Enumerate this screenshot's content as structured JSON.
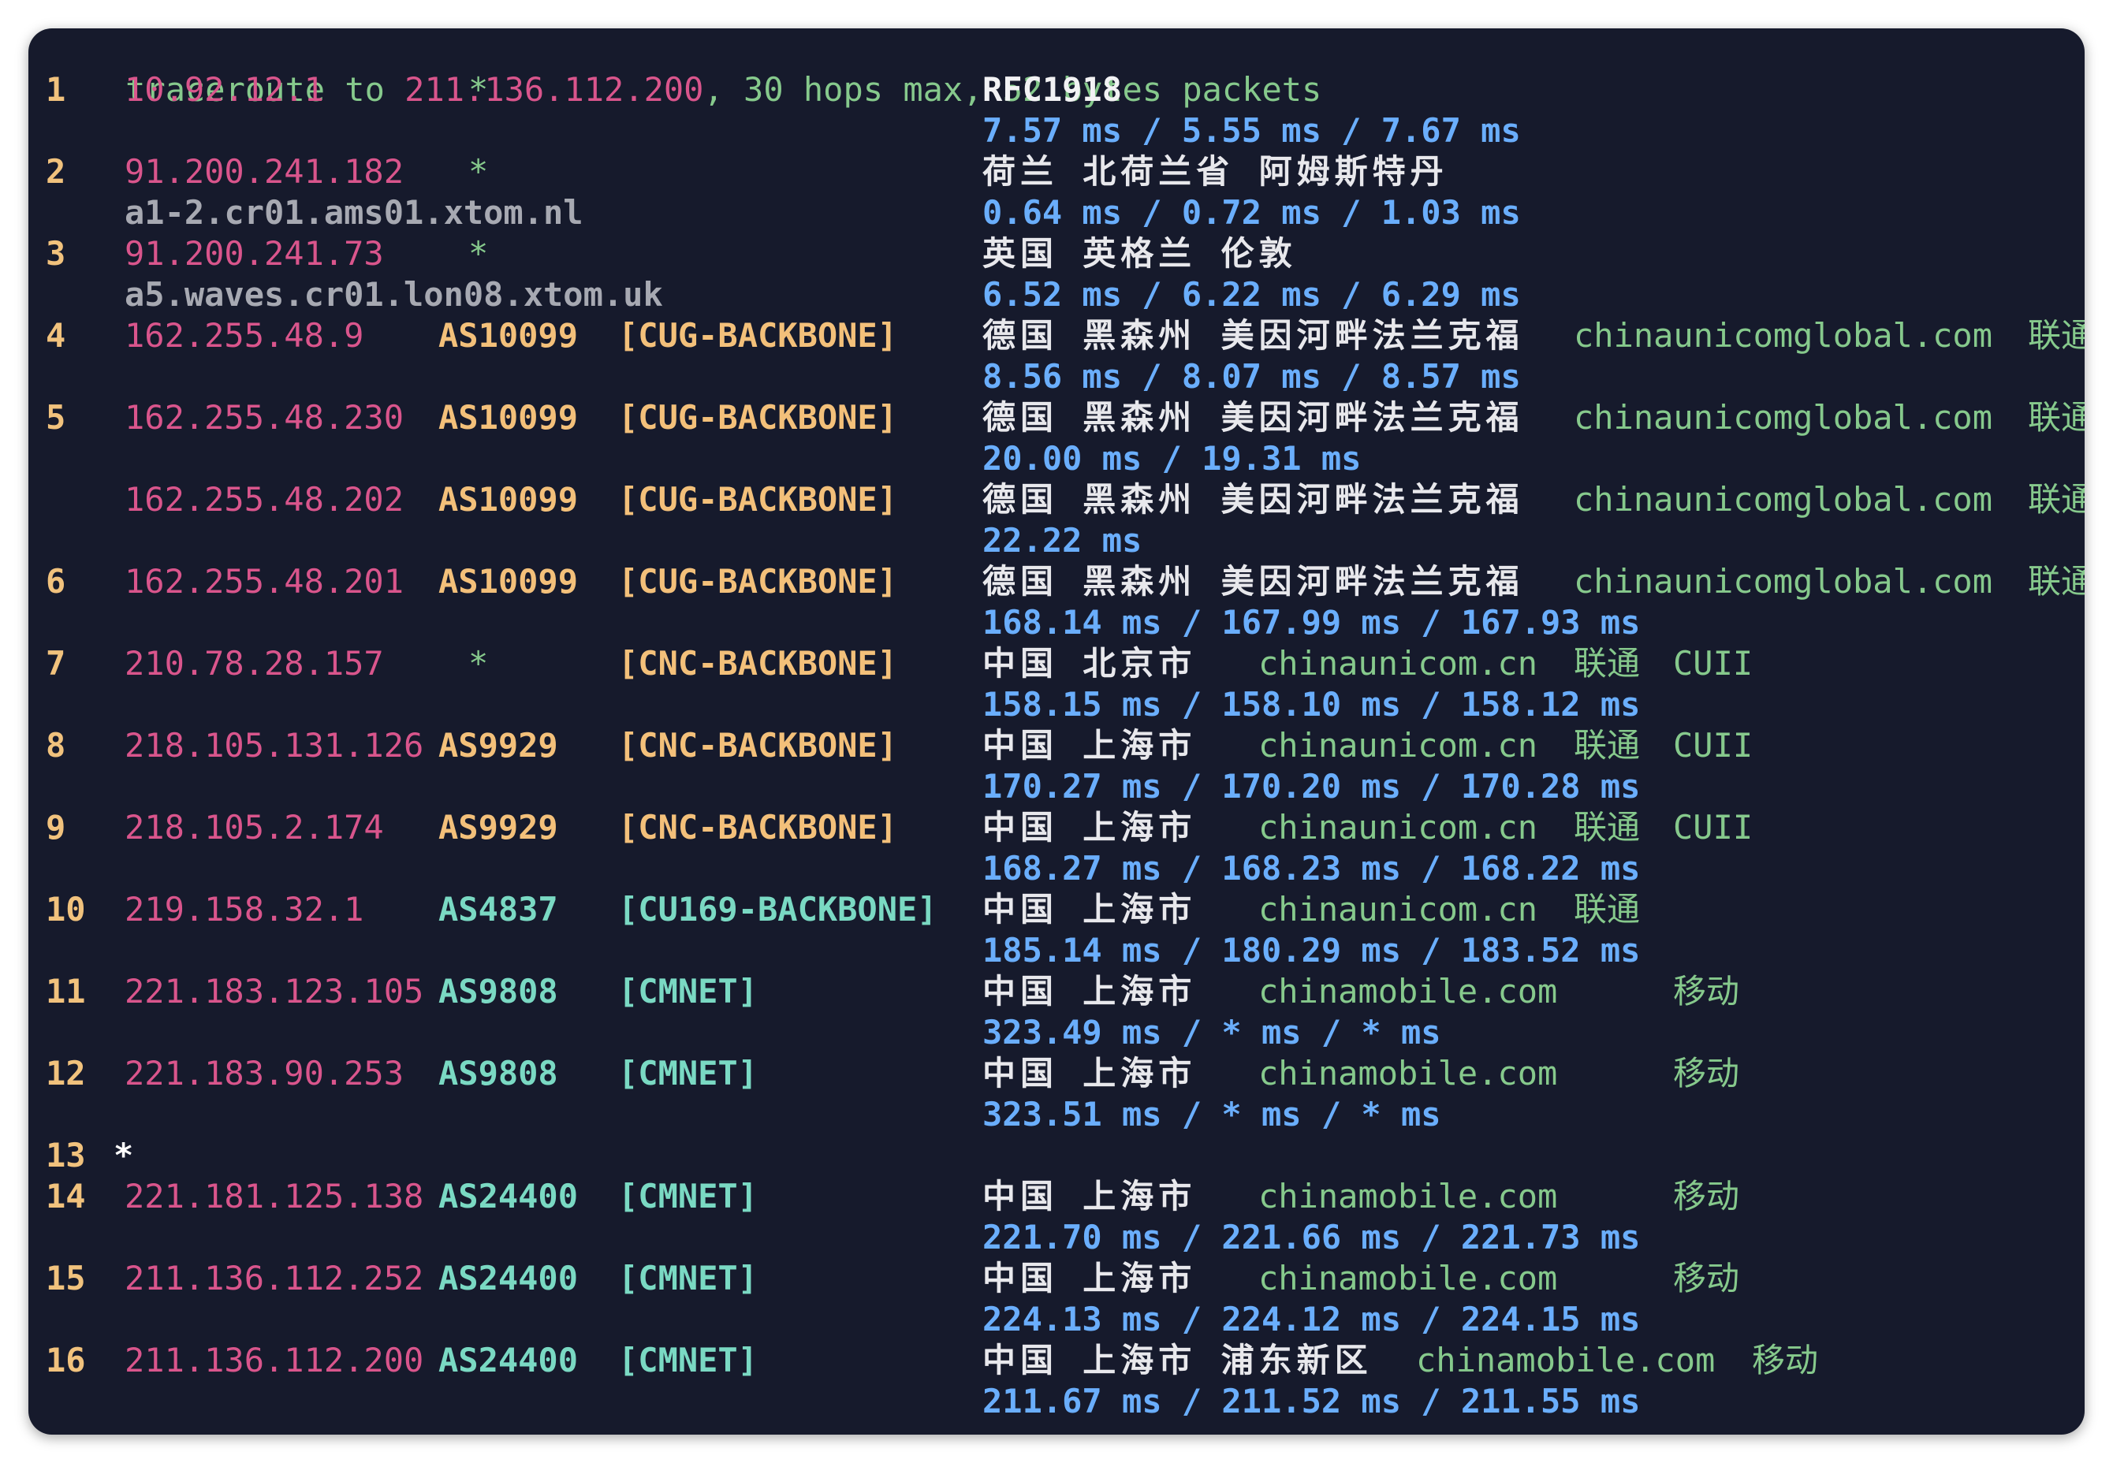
{
  "header": {
    "prefix": "traceroute to ",
    "target": "211.136.112.200",
    "suffix": ", 30 hops max, 52 bytes packets"
  },
  "hops": [
    {
      "hop": "1",
      "ip": "10.92.12.1",
      "asn": "*",
      "tag": "",
      "geo": "RFC1918",
      "domain": "",
      "isp": "",
      "extra": "",
      "host": "",
      "latency": "7.57 ms / 5.55 ms / 7.67 ms"
    },
    {
      "hop": "2",
      "ip": "91.200.241.182",
      "asn": "*",
      "tag": "",
      "geo": "荷兰 北荷兰省 阿姆斯特丹",
      "domain": "",
      "isp": "",
      "extra": "",
      "host": "a1-2.cr01.ams01.xtom.nl",
      "latency": "0.64 ms / 0.72 ms / 1.03 ms"
    },
    {
      "hop": "3",
      "ip": "91.200.241.73",
      "asn": "*",
      "tag": "",
      "geo": "英国 英格兰 伦敦",
      "domain": "",
      "isp": "",
      "extra": "",
      "host": "a5.waves.cr01.lon08.xtom.uk",
      "latency": "6.52 ms / 6.22 ms / 6.29 ms"
    },
    {
      "hop": "4",
      "ip": "162.255.48.9",
      "asn": "AS10099",
      "tag": "[CUG-BACKBONE]",
      "geo": "德国 黑森州 美因河畔法兰克福",
      "domain": "chinaunicomglobal.com",
      "isp": "联通",
      "extra": "",
      "host": "",
      "latency": "8.56 ms / 8.07 ms / 8.57 ms"
    },
    {
      "hop": "5",
      "ip": "162.255.48.230",
      "asn": "AS10099",
      "tag": "[CUG-BACKBONE]",
      "geo": "德国 黑森州 美因河畔法兰克福",
      "domain": "chinaunicomglobal.com",
      "isp": "联通",
      "extra": "",
      "host": "",
      "latency": "20.00 ms / 19.31 ms"
    },
    {
      "hop": "",
      "ip": "162.255.48.202",
      "asn": "AS10099",
      "tag": "[CUG-BACKBONE]",
      "geo": "德国 黑森州 美因河畔法兰克福",
      "domain": "chinaunicomglobal.com",
      "isp": "联通",
      "extra": "",
      "host": "",
      "latency": "22.22 ms"
    },
    {
      "hop": "6",
      "ip": "162.255.48.201",
      "asn": "AS10099",
      "tag": "[CUG-BACKBONE]",
      "geo": "德国 黑森州 美因河畔法兰克福",
      "domain": "chinaunicomglobal.com",
      "isp": "联通",
      "extra": "",
      "host": "",
      "latency": "168.14 ms / 167.99 ms / 167.93 ms"
    },
    {
      "hop": "7",
      "ip": "210.78.28.157",
      "asn": "*",
      "tag": "[CNC-BACKBONE]",
      "geo": "中国 北京市",
      "domain": "chinaunicom.cn",
      "isp": "联通",
      "extra": "CUII",
      "host": "",
      "latency": "158.15 ms / 158.10 ms / 158.12 ms"
    },
    {
      "hop": "8",
      "ip": "218.105.131.126",
      "asn": "AS9929",
      "tag": "[CNC-BACKBONE]",
      "geo": "中国 上海市",
      "domain": "chinaunicom.cn",
      "isp": "联通",
      "extra": "CUII",
      "host": "",
      "latency": "170.27 ms / 170.20 ms / 170.28 ms"
    },
    {
      "hop": "9",
      "ip": "218.105.2.174",
      "asn": "AS9929",
      "tag": "[CNC-BACKBONE]",
      "geo": "中国 上海市",
      "domain": "chinaunicom.cn",
      "isp": "联通",
      "extra": "CUII",
      "host": "",
      "latency": "168.27 ms / 168.23 ms / 168.22 ms"
    },
    {
      "hop": "10",
      "ip": "219.158.32.1",
      "asn": "AS4837",
      "tag": "[CU169-BACKBONE]",
      "geo": "中国 上海市",
      "domain": "chinaunicom.cn",
      "isp": "联通",
      "extra": "",
      "host": "",
      "latency": "185.14 ms / 180.29 ms / 183.52 ms"
    },
    {
      "hop": "11",
      "ip": "221.183.123.105",
      "asn": "AS9808",
      "tag": "[CMNET]",
      "geo": "中国 上海市",
      "domain": "chinamobile.com",
      "isp": "移动",
      "extra": "",
      "host": "",
      "latency": "323.49 ms / * ms / * ms"
    },
    {
      "hop": "12",
      "ip": "221.183.90.253",
      "asn": "AS9808",
      "tag": "[CMNET]",
      "geo": "中国 上海市",
      "domain": "chinamobile.com",
      "isp": "移动",
      "extra": "",
      "host": "",
      "latency": "323.51 ms / * ms / * ms"
    },
    {
      "hop": "13",
      "ip": "*",
      "asn": "",
      "tag": "",
      "geo": "",
      "domain": "",
      "isp": "",
      "extra": "",
      "host": "",
      "latency": ""
    },
    {
      "hop": "14",
      "ip": "221.181.125.138",
      "asn": "AS24400",
      "tag": "[CMNET]",
      "geo": "中国 上海市",
      "domain": "chinamobile.com",
      "isp": "移动",
      "extra": "",
      "host": "",
      "latency": "221.70 ms / 221.66 ms / 221.73 ms"
    },
    {
      "hop": "15",
      "ip": "211.136.112.252",
      "asn": "AS24400",
      "tag": "[CMNET]",
      "geo": "中国 上海市",
      "domain": "chinamobile.com",
      "isp": "移动",
      "extra": "",
      "host": "",
      "latency": "224.13 ms / 224.12 ms / 224.15 ms"
    },
    {
      "hop": "16",
      "ip": "211.136.112.200",
      "asn": "AS24400",
      "tag": "[CMNET]",
      "geo": "中国 上海市 浦东新区",
      "domain": "chinamobile.com",
      "isp": "移动",
      "extra": "",
      "host": "",
      "latency": "211.67 ms / 211.52 ms / 211.55 ms"
    }
  ]
}
